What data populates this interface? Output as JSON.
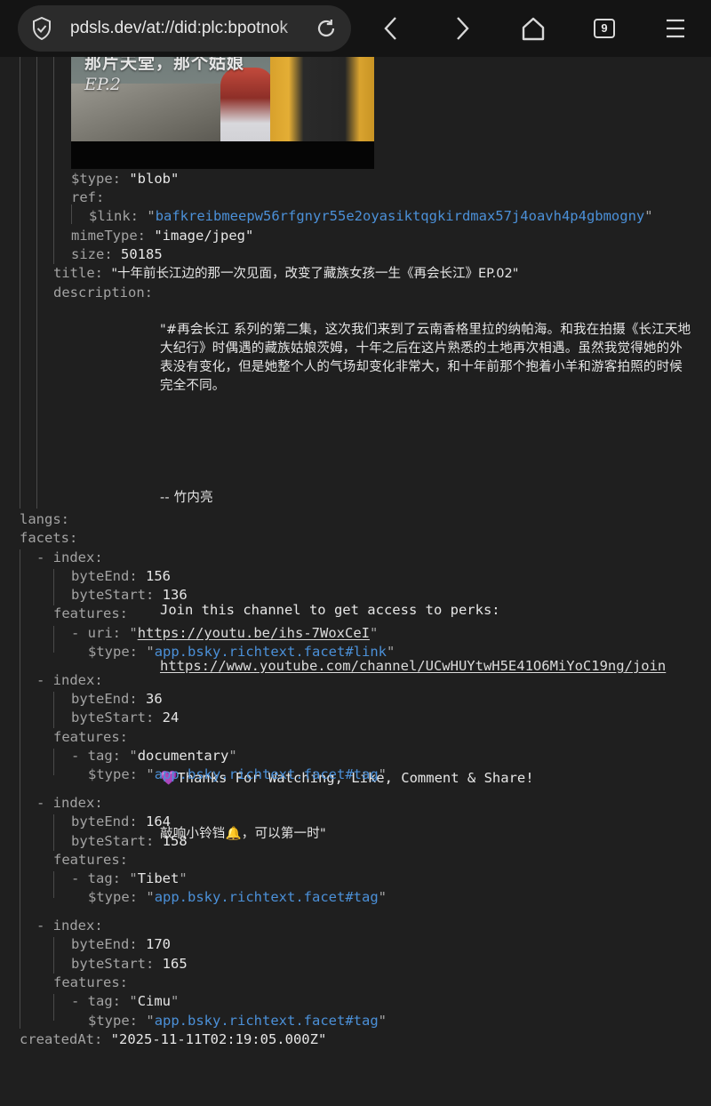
{
  "browser": {
    "url": "pdsls.dev/at://did:plc:bpotnok",
    "tab_count": "9",
    "icons": [
      "site-shield-icon",
      "reload-icon",
      "back-icon",
      "forward-icon",
      "home-icon",
      "tab-count-icon",
      "menu-icon"
    ]
  },
  "thumbnail": {
    "title_text": "那片天堂，那个姑娘",
    "ep_text": "EP.2"
  },
  "record": {
    "blob": {
      "type_key": "$type:",
      "type_val": "\"blob\"",
      "ref_key": "ref:",
      "link_key": "$link:",
      "link_val": "bafkreibmeepw56rfgnyr55e2oyasiktqgkirdmax57j4oavh4p4gbmogny",
      "mime_key": "mimeType:",
      "mime_val": "\"image/jpeg\"",
      "size_key": "size:",
      "size_val": "50185"
    },
    "title_key": "title:",
    "title_val": "\"十年前长江边的那一次见面，改变了藏族女孩一生《再会长江》EP.02\"",
    "description_key": "description:",
    "description_zh": "\"#再会长江 系列的第二集，这次我们来到了云南香格里拉的纳帕海。和我在拍摄《长江天地大纪行》时偶遇的藏族姑娘茨姆，十年之后在这片熟悉的土地再次相遇。虽然我觉得她的外表没有变化，但是她整个人的气场却变化非常大，和十年前那个抱着小羊和游客拍照的时候完全不同。",
    "description_sig": "-- 竹内亮",
    "description_join": "Join this channel to get access to perks:",
    "description_url": "https://www.youtube.com/channel/UCwHUYtwH5E41O6MiYoC19ng/join",
    "description_thanks": "💜Thanks For Watching, Like, Comment & Share!",
    "description_bell": "敲响小铃铛🔔，可以第一时\"",
    "langs_key": "langs:",
    "facets_key": "facets:",
    "facets": [
      {
        "byteEnd": "156",
        "byteStart": "136",
        "feature_key": "uri:",
        "feature_val": "https://youtu.be/ihs-7WoxCeI",
        "type": "app.bsky.richtext.facet#link"
      },
      {
        "byteEnd": "36",
        "byteStart": "24",
        "feature_key": "tag:",
        "feature_val": "documentary",
        "type": "app.bsky.richtext.facet#tag"
      },
      {
        "byteEnd": "164",
        "byteStart": "158",
        "feature_key": "tag:",
        "feature_val": "Tibet",
        "type": "app.bsky.richtext.facet#tag"
      },
      {
        "byteEnd": "170",
        "byteStart": "165",
        "feature_key": "tag:",
        "feature_val": "Cimu",
        "type": "app.bsky.richtext.facet#tag"
      }
    ],
    "labels": {
      "index": "- index:",
      "byteEnd": "byteEnd:",
      "byteStart": "byteStart:",
      "features": "features:",
      "type": "$type:"
    },
    "created_key": "createdAt:",
    "created_val": "\"2025-11-11T02:19:05.000Z\""
  },
  "colors": {
    "background": "#1f1f1f",
    "key": "#a3a3a3",
    "value": "#e6e6e6",
    "link": "#4b90d8",
    "topbar": "#141414"
  }
}
